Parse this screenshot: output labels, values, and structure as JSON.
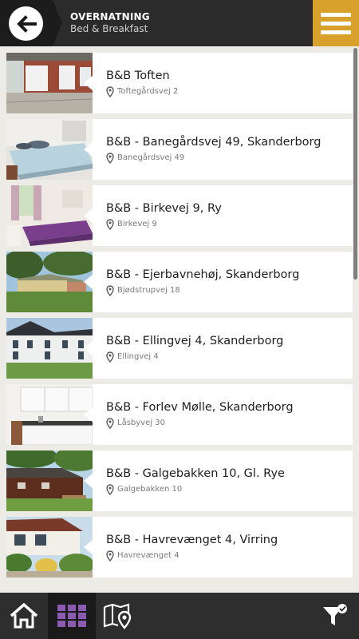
{
  "header": {
    "title": "OVERNATNING",
    "subtitle": "Bed & Breakfast",
    "back_icon": "arrow-left-icon",
    "menu_icon": "hamburger-menu-icon",
    "accent_color": "#d8a12c"
  },
  "listings": [
    {
      "name": "B&B Toften",
      "address": "Toftegårdsvej 2"
    },
    {
      "name": "B&B - Banegårdsvej 49, Skanderborg",
      "address": "Banegårdsvej 49"
    },
    {
      "name": "B&B - Birkevej 9, Ry",
      "address": "Birkevej 9"
    },
    {
      "name": "B&B - Ejerbavnehøj, Skanderborg",
      "address": "Bjødstrupvej 18"
    },
    {
      "name": "B&B - Ellingvej 4, Skanderborg",
      "address": "Ellingvej 4"
    },
    {
      "name": "B&B - Forlev Mølle, Skanderborg",
      "address": "Låsbyvej 30"
    },
    {
      "name": "B&B - Galgebakken 10, Gl. Rye",
      "address": "Galgebakken 10"
    },
    {
      "name": "B&B - Havrevænget 4, Virring",
      "address": "Havrevænget 4"
    }
  ],
  "bottom_nav": {
    "items": [
      "home-icon",
      "grid-icon",
      "map-icon",
      "filter-icon"
    ],
    "active": "grid-icon",
    "active_color": "#8a5bb0"
  }
}
